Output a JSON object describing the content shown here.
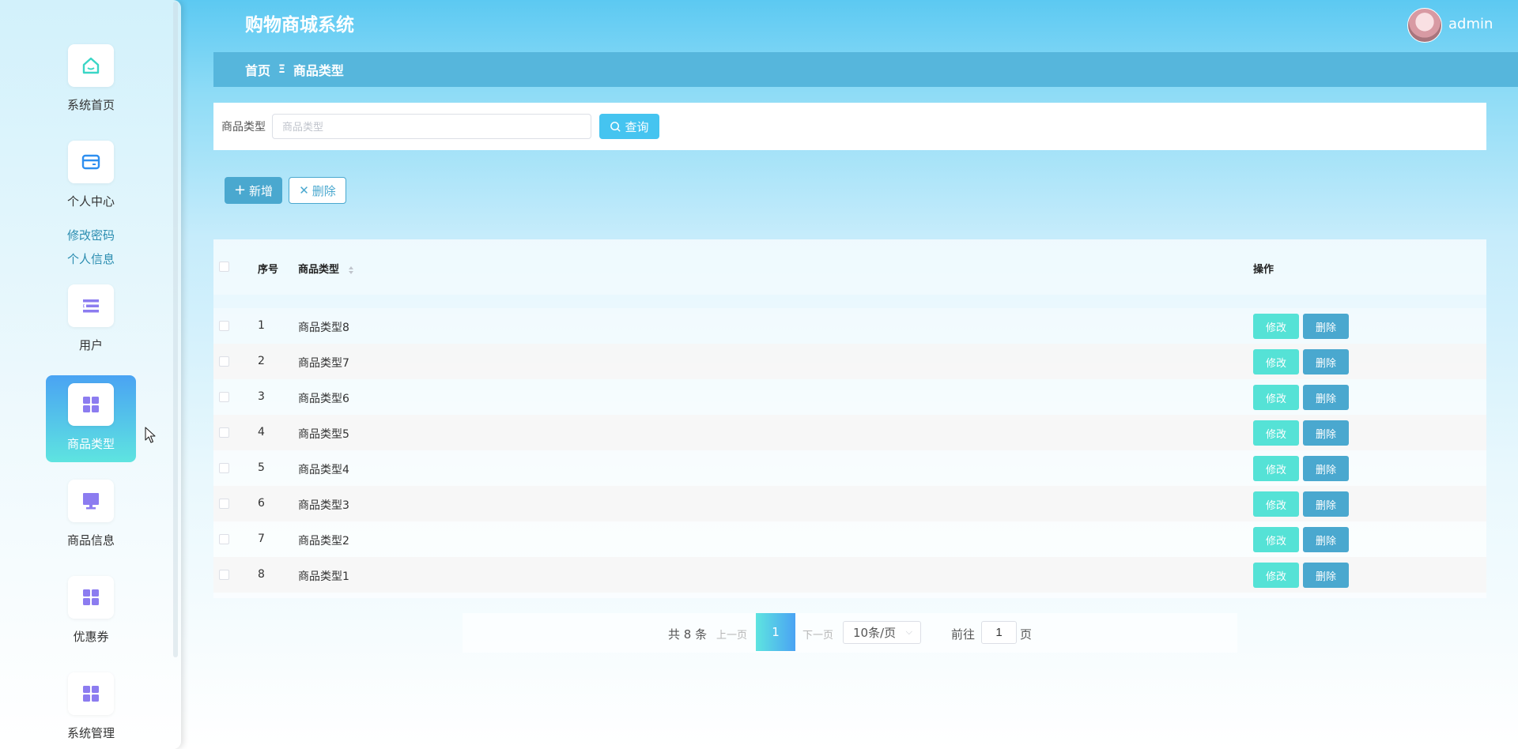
{
  "app": {
    "title": "购物商城系统",
    "username": "admin"
  },
  "sidebar": {
    "items": [
      {
        "label": "系统首页",
        "icon": "home-icon"
      },
      {
        "label": "个人中心",
        "icon": "wallet-icon"
      },
      {
        "label": "用户",
        "icon": "list-icon"
      },
      {
        "label": "商品类型",
        "icon": "grid-icon",
        "active": true
      },
      {
        "label": "商品信息",
        "icon": "monitor-icon"
      },
      {
        "label": "优惠券",
        "icon": "grid-icon"
      },
      {
        "label": "系统管理",
        "icon": "grid-icon"
      }
    ],
    "submenu": [
      "修改密码",
      "个人信息"
    ]
  },
  "breadcrumb": {
    "home": "首页",
    "separator": "Ξ",
    "current": "商品类型"
  },
  "search": {
    "label": "商品类型",
    "placeholder": "商品类型",
    "button": "查询"
  },
  "actions": {
    "add": "新增",
    "delete": "删除"
  },
  "table": {
    "headers": {
      "index": "序号",
      "type": "商品类型",
      "ops": "操作"
    },
    "rows": [
      {
        "index": "1",
        "type": "商品类型8"
      },
      {
        "index": "2",
        "type": "商品类型7"
      },
      {
        "index": "3",
        "type": "商品类型6"
      },
      {
        "index": "4",
        "type": "商品类型5"
      },
      {
        "index": "5",
        "type": "商品类型4"
      },
      {
        "index": "6",
        "type": "商品类型3"
      },
      {
        "index": "7",
        "type": "商品类型2"
      },
      {
        "index": "8",
        "type": "商品类型1"
      }
    ],
    "edit_label": "修改",
    "delete_label": "删除"
  },
  "pagination": {
    "total": "共 8 条",
    "prev": "上一页",
    "current": "1",
    "next": "下一页",
    "page_size": "10条/页",
    "goto": "前往",
    "goto_value": "1",
    "page_suffix": "页"
  },
  "colors": {
    "accent": "#45c4f0",
    "primary_button": "#4aa8cf",
    "edit_button": "#55e2d6",
    "breadcrumb_bar": "#56b6dc"
  }
}
